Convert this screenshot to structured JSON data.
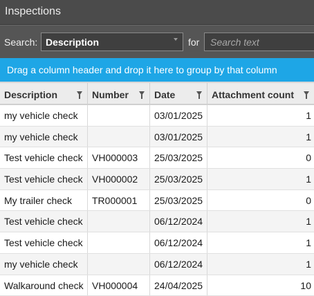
{
  "window": {
    "title": "Inspections"
  },
  "search": {
    "label": "Search:",
    "field_value": "Description",
    "for_label": "for",
    "placeholder": "Search text"
  },
  "group_panel": {
    "text": "Drag a column header and drop it here to group by that column"
  },
  "columns": [
    {
      "label": "Description"
    },
    {
      "label": "Number"
    },
    {
      "label": "Date"
    },
    {
      "label": "Attachment count"
    }
  ],
  "rows": [
    {
      "description": "my vehicle check",
      "number": "",
      "date": "03/01/2025",
      "attachments": "1"
    },
    {
      "description": "my vehicle check",
      "number": "",
      "date": "03/01/2025",
      "attachments": "1"
    },
    {
      "description": "Test  vehicle check",
      "number": "VH000003",
      "date": "25/03/2025",
      "attachments": "0"
    },
    {
      "description": "Test  vehicle check",
      "number": "VH000002",
      "date": "25/03/2025",
      "attachments": "1"
    },
    {
      "description": "My trailer check",
      "number": "TR000001",
      "date": "25/03/2025",
      "attachments": "0"
    },
    {
      "description": "Test  vehicle check",
      "number": "",
      "date": "06/12/2024",
      "attachments": "1"
    },
    {
      "description": "Test  vehicle check",
      "number": "",
      "date": "06/12/2024",
      "attachments": "1"
    },
    {
      "description": "my vehicle check",
      "number": "",
      "date": "06/12/2024",
      "attachments": "1"
    },
    {
      "description": "Walkaround check",
      "number": "VH000004",
      "date": "24/04/2025",
      "attachments": "10"
    }
  ]
}
